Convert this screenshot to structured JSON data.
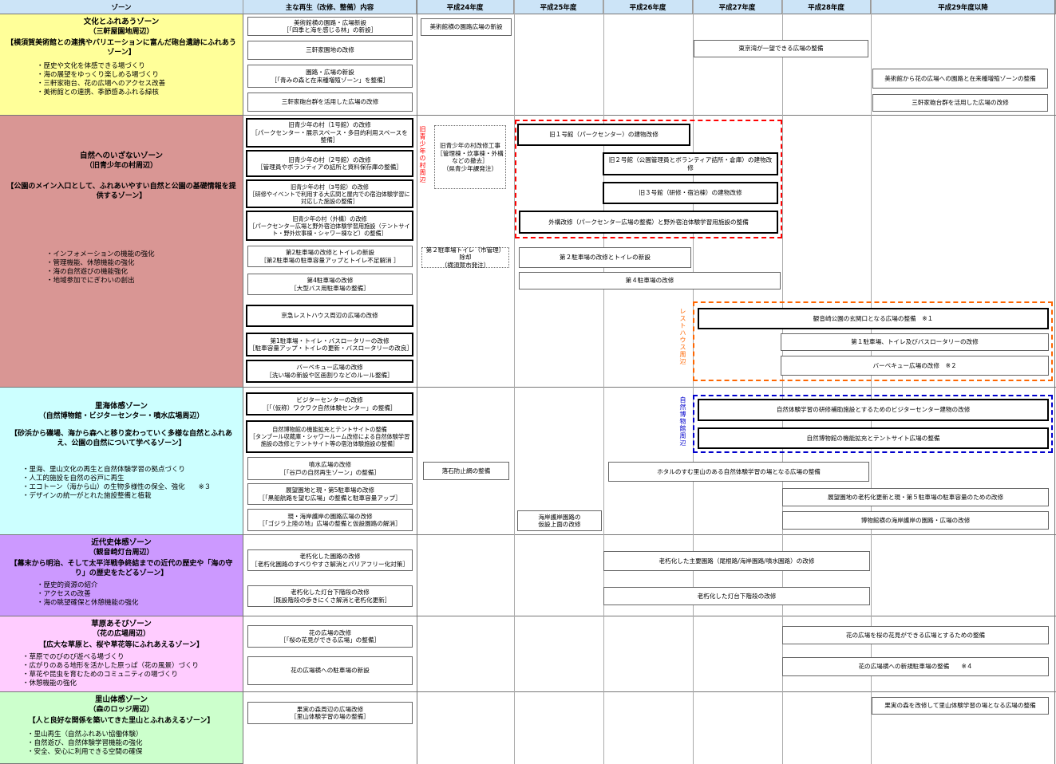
{
  "header": {
    "zone": "ゾーン",
    "content": "主な再生（改修、整備）内容",
    "y24": "平成24年度",
    "y25": "平成25年度",
    "y26": "平成26年度",
    "y27": "平成27年度",
    "y28": "平成28年度",
    "y29": "平成29年度以降"
  },
  "colors": {
    "header": "#cce4f7",
    "zone1": "#ffff99",
    "zone2": "#d99694",
    "zone3": "#ccffff",
    "zone4": "#cc99ff",
    "zone5": "#ffccff",
    "zone6": "#ccffcc",
    "red_dash": "#ff0000",
    "orange_dash": "#ff6600",
    "blue_dash": "#0000cc"
  },
  "zones": [
    {
      "title": "文化とふれあうゾーン",
      "sub": "（三軒屋園地周辺）",
      "desc": "【横須賀美術館との連携やバリエーションに富んだ砲台遺跡にふれあうゾーン】",
      "items": [
        "歴史や文化を体感できる場づくり",
        "海の展望をゆっくり楽しめる場づくり",
        "三軒家砲台、花の広場へのアクセス改善",
        "美術館との連携、季節感あふれる緑核"
      ]
    },
    {
      "title": "自然へのいざないゾーン",
      "sub": "（旧青少年の村周辺）",
      "desc": "【公園のメイン入口として、ふれあいやすい自然と公園の基礎情報を提供するゾーン】",
      "items": [
        "インフォメーションの機能の強化",
        "管理機能、休憩機能の強化",
        "海の自然遊びの機能強化",
        "地域参加でにぎわいの創出"
      ]
    },
    {
      "title": "里海体感ゾーン",
      "sub": "（自然博物館・ビジターセンター・噴水広場周辺）",
      "desc": "【砂浜から磯場、海から森へと移り変わっていく多様な自然とふれあえ、公園の自然について学べるゾーン】",
      "items": [
        "里海、里山文化の再生と自然体験学習の拠点づくり",
        "人工的施設を自然の谷戸に再生",
        "エコトーン（海から山）の生物多様性の保全、強化　　※３",
        "デザインの統一がとれた施設整備と植栽"
      ]
    },
    {
      "title": "近代史体感ゾーン",
      "sub": "（観音崎灯台周辺）",
      "desc": "【幕末から明治、そして太平洋戦争終結までの近代の歴史や「海の守り」の歴史をたどるゾーン】",
      "items": [
        "歴史的資源の紹介",
        "アクセスの改善",
        "海の眺望確保と休憩機能の強化"
      ]
    },
    {
      "title": "草原あそびゾーン",
      "sub": "（花の広場周辺）",
      "desc": "【広大な草原と、桜や草花等にふれあえるゾーン】",
      "items": [
        "草原でのびのび遊べる場づくり",
        "広がりのある地形を活かした原っぱ（花の風景）づくり",
        "草花や昆虫を育むためのコミュニティの場づくり",
        "休憩機能の強化"
      ]
    },
    {
      "title": "里山体感ゾーン",
      "sub": "（森のロッジ周辺）",
      "desc": "【人と良好な関係を築いてきた里山とふれあえるゾーン】",
      "items": [
        "里山再生（自然ふれあい協働体験）",
        "自然遊び、自然体験学習機能の強化",
        "安全、安心に利用できる空間の確保"
      ]
    }
  ],
  "content_items": [
    {
      "l1": "美術館横の園路・広場新設",
      "l2": "［「四季と海を感じる林」の新設］"
    },
    {
      "l1": "三軒家園地の改修",
      "l2": ""
    },
    {
      "l1": "園路・広場の新設",
      "l2": "［「青みの森と在来種増殖ゾーン」を整備］"
    },
    {
      "l1": "三軒家砲台群を活用した広場の改修",
      "l2": ""
    },
    {
      "l1": "旧青少年の村（1号館）の改修",
      "l2": "［パークセンター・展示スペース・多目的利用スペースを整備］"
    },
    {
      "l1": "旧青少年の村（2号館）の改修",
      "l2": "［管理員やボランティアの詰所と資料保存庫の整備］"
    },
    {
      "l1": "旧青少年の村（3号館）の改修",
      "l2": "［研修やイベントで利用する大広間と屋内での宿泊体験学習に対応した施設の整備］"
    },
    {
      "l1": "旧青少年の村（外構）の改修",
      "l2": "［パークセンター広場と野外宿泊体験学習用施設（テントサイト・野外炊事棟・シャワー棟など）の整備］"
    },
    {
      "l1": "第2駐車場の改修とトイレの新設",
      "l2": "［第2駐車場の駐車容量アップとトイレ不足解消 ］"
    },
    {
      "l1": "第4駐車場の改修",
      "l2": "［大型バス用駐車場の整備］"
    },
    {
      "l1": "京急レストハウス周辺の広場の改修",
      "l2": ""
    },
    {
      "l1": "第1駐車場・トイレ・バスロータリーの改修",
      "l2": "［駐車容量アップ・トイレの更新・バスロータリーの改良］"
    },
    {
      "l1": "バーベキュー広場の改修",
      "l2": "［洗い場の新設や区画割りなどのルール整備］"
    },
    {
      "l1": "ビジターセンターの改修",
      "l2": "［「（仮称）ワクワク自然体験センター」の整備］"
    },
    {
      "l1": "自然博物館の機能拡充とテントサイトの整備",
      "l2": "［タンブール収蔵庫・シャワールーム改修による自然体験学習施設の改修とテントサイト等の宿泊体験施設の整備］"
    },
    {
      "l1": "噴水広場の改修",
      "l2": "［「谷戸の自然再生ゾーン」の整備］"
    },
    {
      "l1": "展望園地と現・第5駐車場の改修",
      "l2": "［「黒船航路を望む広場」の整備と駐車容量アップ］"
    },
    {
      "l1": "現・海岸護岸の園路広場の改修",
      "l2": "［「ゴジラ上陸の地」広場の整備と仮設園路の解消］"
    },
    {
      "l1": "老朽化した園路の改修",
      "l2": "［老朽化園路のすべりやすさ解消とバリアフリー化対策］"
    },
    {
      "l1": "老朽化した灯台下階段の改修",
      "l2": "［既設階段の歩きにくさ解消と老朽化更新］"
    },
    {
      "l1": "花の広場の改修",
      "l2": "［「桜の花見ができる広場」の整備］"
    },
    {
      "l1": "花の広場横への駐車場の新設",
      "l2": ""
    },
    {
      "l1": "果実の森周辺の広場改修",
      "l2": "［里山体験学習の場の整備］"
    }
  ],
  "schedule": {
    "s1": "美術館横の園路広場の新設",
    "s2": "東京湾が一望できる広場の整備",
    "s3": "美術館から花の広場への園路と在来種増殖ゾーンの整備",
    "s4": "三軒家砲台群を活用した広場の改修",
    "s5a": "旧青少年の村改修工事",
    "s5b": "［管理棟・炊事棟・外構などの撤去］",
    "s5c": "（県青少年課発注）",
    "s6": "旧１号館（パークセンター）の建物改修",
    "s7": "旧２号館（公園管理員とボランティア詰所・倉庫）の建物改修",
    "s8": "旧３号館（研修・宿泊棟）の建物改修",
    "s9": "外構改修（パークセンター広場の整備）と野外宿泊体験学習用施設の整備",
    "s10a": "第２駐車場トイレ（市管理）除却",
    "s10b": "（横須賀市発注）",
    "s11": "第２駐車場の改修とトイレの新設",
    "s12": "第４駐車場の改修",
    "s13": "観音崎公園の玄関口となる広場の整備　※１",
    "s14": "第１駐車場、トイレ及びバスロータリーの改修",
    "s15": "バーベキュー広場の改修　※２",
    "s16": "自然体験学習の研修補助施設とするためのビジターセンター建物の改修",
    "s17": "自然博物館の機能拡充とテントサイト広場の整備",
    "s18": "落石防止網の整備",
    "s19": "ホタルのすむ里山のある自然体験学習の場となる広場の整備",
    "s20": "展望園地の老朽化更新と現・第５駐車場の駐車容量のための改修",
    "s21a": "海岸護岸園路の",
    "s21b": "仮設上面の改修",
    "s22": "博物館横の海岸護岸の園路・広場の改修",
    "s23": "老朽化した主要園路（尾根路/海岸園路/噴水園路）の改修",
    "s24": "老朽化した灯台下階段の改修",
    "s25": "花の広場を桜の花見ができる広場とするための整備",
    "s26": "花の広場横への新規駐車場の整備　　※４",
    "s27": "果実の森を改修して里山体験学習の場となる広場の整備"
  },
  "side_labels": {
    "red": "旧青少年の村周辺",
    "orange": "レストハウス周辺",
    "blue": "自然博物館周辺"
  }
}
